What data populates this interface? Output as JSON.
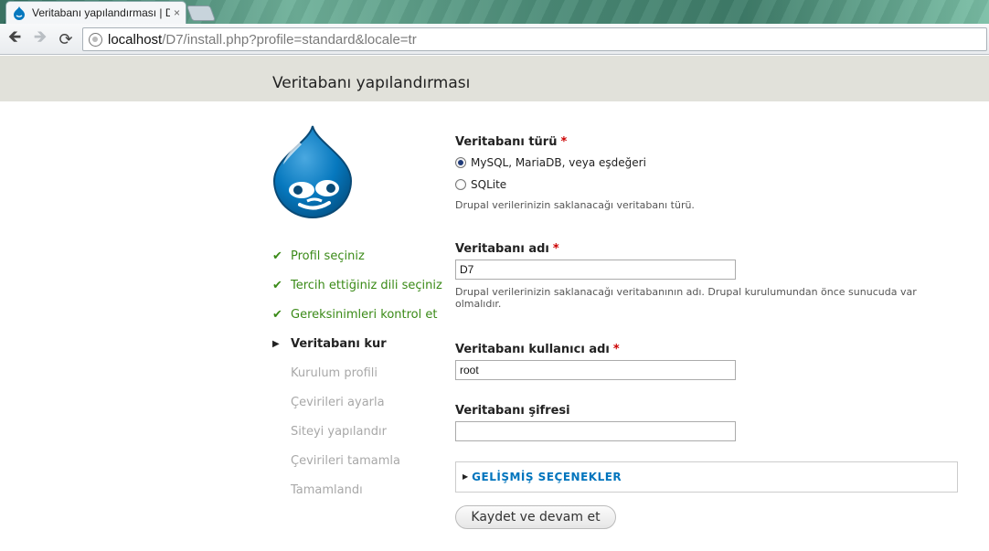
{
  "browser": {
    "tab_title": "Veritabanı yapılandırması | D",
    "tab_close": "×",
    "url_host": "localhost",
    "url_path": "/D7/install.php?profile=standard&locale=tr",
    "back_icon": "back-arrow-icon",
    "forward_icon": "forward-arrow-icon",
    "reload_icon": "reload-icon"
  },
  "page": {
    "title": "Veritabanı yapılandırması"
  },
  "steps": [
    {
      "label": "Profil seçiniz",
      "state": "done"
    },
    {
      "label": "Tercih ettiğiniz dili seçiniz",
      "state": "done"
    },
    {
      "label": "Gereksinimleri kontrol et",
      "state": "done"
    },
    {
      "label": "Veritabanı kur",
      "state": "active"
    },
    {
      "label": "Kurulum profili",
      "state": "todo"
    },
    {
      "label": "Çevirileri ayarla",
      "state": "todo"
    },
    {
      "label": "Siteyi yapılandır",
      "state": "todo"
    },
    {
      "label": "Çevirileri tamamla",
      "state": "todo"
    },
    {
      "label": "Tamamlandı",
      "state": "todo"
    }
  ],
  "form": {
    "db_type": {
      "label": "Veritabanı türü",
      "required": "*",
      "options": [
        "MySQL, MariaDB, veya eşdeğeri",
        "SQLite"
      ],
      "selected": "MySQL, MariaDB, veya eşdeğeri",
      "description": "Drupal verilerinizin saklanacağı veritabanı türü."
    },
    "db_name": {
      "label": "Veritabanı adı",
      "required": "*",
      "value": "D7",
      "description": "Drupal verilerinizin saklanacağı veritabanının adı. Drupal kurulumundan önce sunucuda var olmalıdır."
    },
    "db_user": {
      "label": "Veritabanı kullanıcı adı",
      "required": "*",
      "value": "root"
    },
    "db_pass": {
      "label": "Veritabanı şifresi",
      "value": ""
    },
    "advanced": {
      "label": "GELİŞMİŞ SEÇENEKLER"
    },
    "submit_label": "Kaydet ve devam et"
  },
  "colors": {
    "header_bg": "#e1e1da",
    "done_green": "#3a8a17",
    "link_blue": "#0074bd",
    "required_red": "#cc0000",
    "drupal_blue": "#0678be"
  }
}
